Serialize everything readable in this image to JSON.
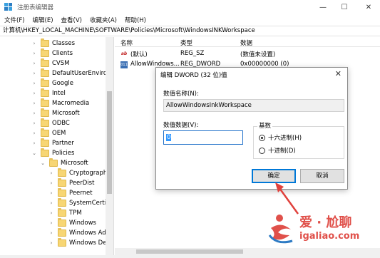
{
  "window": {
    "title": "注册表编辑器",
    "minimize": "—",
    "maximize": "☐",
    "close": "✕"
  },
  "menu": [
    "文件(F)",
    "编辑(E)",
    "查看(V)",
    "收藏夹(A)",
    "帮助(H)"
  ],
  "address": "计算机\\HKEY_LOCAL_MACHINE\\SOFTWARE\\Policies\\Microsoft\\WindowsINKWorkspace",
  "tree": [
    {
      "label": "Classes",
      "arrow": "›"
    },
    {
      "label": "Clients",
      "arrow": "›"
    },
    {
      "label": "CVSM",
      "arrow": "›"
    },
    {
      "label": "DefaultUserEnvironr",
      "arrow": "›"
    },
    {
      "label": "Google",
      "arrow": "›"
    },
    {
      "label": "Intel",
      "arrow": "›"
    },
    {
      "label": "Macromedia",
      "arrow": "›"
    },
    {
      "label": "Microsoft",
      "arrow": "›"
    },
    {
      "label": "ODBC",
      "arrow": "›"
    },
    {
      "label": "OEM",
      "arrow": "›"
    },
    {
      "label": "Partner",
      "arrow": "›"
    },
    {
      "label": "Policies",
      "arrow": "⌄"
    },
    {
      "label": "Microsoft",
      "arrow": "⌄"
    },
    {
      "label": "Cryptography",
      "arrow": "›"
    },
    {
      "label": "PeerDist",
      "arrow": "›"
    },
    {
      "label": "Peernet",
      "arrow": "›"
    },
    {
      "label": "SystemCertifica",
      "arrow": "›"
    },
    {
      "label": "TPM",
      "arrow": "›"
    },
    {
      "label": "Windows",
      "arrow": "›"
    },
    {
      "label": "Windows Adva",
      "arrow": "›"
    },
    {
      "label": "Windows Defe",
      "arrow": "›"
    }
  ],
  "list": {
    "headers": {
      "name": "名称",
      "type": "类型",
      "data": "数据"
    },
    "rows": [
      {
        "icon": "ab",
        "name": "(默认)",
        "type": "REG_SZ",
        "data": "(数值未设置)"
      },
      {
        "icon": "011",
        "name": "AllowWindows...",
        "type": "REG_DWORD",
        "data": "0x00000000 (0)"
      }
    ]
  },
  "dialog": {
    "title": "编辑 DWORD (32 位)值",
    "close": "✕",
    "name_label": "数值名称(N):",
    "name_value": "AllowWindowsInkWorkspace",
    "data_label": "数值数据(V):",
    "data_value": "0",
    "base_label": "基数",
    "hex_label": "十六进制(H)",
    "dec_label": "十进制(D)",
    "ok": "确定",
    "cancel": "取消"
  },
  "watermark": {
    "brand": "爱 · 尬聊",
    "url": "igaliao.com"
  },
  "colors": {
    "accent": "#0078d7",
    "annotation_arrow": "#e0413c"
  }
}
